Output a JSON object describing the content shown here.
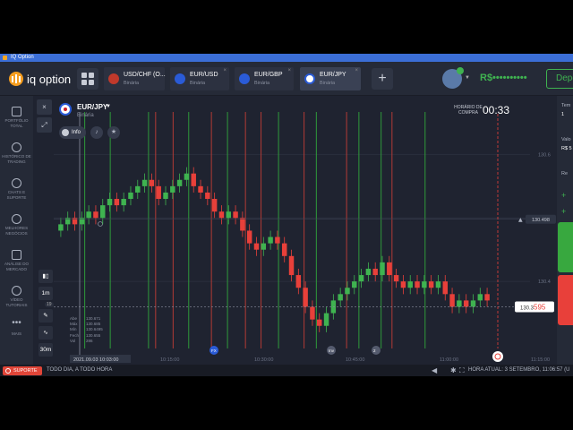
{
  "window": {
    "title": "IQ Option"
  },
  "brand": {
    "name": "iq option"
  },
  "tabs": [
    {
      "name": "USD/CHF (O...",
      "type": "Binária",
      "flag_color": "#c0392b"
    },
    {
      "name": "EUR/USD",
      "type": "Binária",
      "flag_color": "#2a5bd7"
    },
    {
      "name": "EUR/GBP",
      "type": "Binária",
      "flag_color": "#2a5bd7"
    },
    {
      "name": "EUR/JPY",
      "type": "Binária",
      "flag_color": "#2a5bd7"
    }
  ],
  "account": {
    "balance": "R$••••••••••",
    "deposit": "Depo"
  },
  "sidebar": [
    {
      "label": "PORTFÓLIO TOTAL",
      "icon": "briefcase-icon"
    },
    {
      "label": "HISTÓRICO DE TRADING",
      "icon": "history-icon"
    },
    {
      "label": "CHATS E SUPORTE",
      "icon": "chat-icon"
    },
    {
      "label": "MELHORES NEGÓCIOS",
      "icon": "trophy-icon"
    },
    {
      "label": "ANÁLISE DO MERCADO",
      "icon": "news-icon"
    },
    {
      "label": "VÍDEO TUTORIAIS",
      "icon": "play-icon"
    },
    {
      "label": "MAIS",
      "icon": "more-icon"
    }
  ],
  "asset": {
    "name": "EUR/JPY",
    "type": "Binária",
    "info": "Info"
  },
  "countdown": {
    "label": "HORÁRIO DE COMPRA",
    "value": "00:33"
  },
  "timeframes": {
    "candle": "1m",
    "period": "30m",
    "indicator_count": "19"
  },
  "ohlc": [
    {
      "k": "Abe",
      "v": "130.671"
    },
    {
      "k": "Máx",
      "v": "130.685"
    },
    {
      "k": "Mín",
      "v": "130.6495"
    },
    {
      "k": "Fech",
      "v": "130.655"
    },
    {
      "k": "Vol",
      "v": "286"
    }
  ],
  "right_panel": {
    "t1": "Tem",
    "t2": "1",
    "t3": "Valo",
    "t4": "R$ 5",
    "t5": "Re",
    "t6": "+",
    "t7": "+"
  },
  "bottom": {
    "support": "SUPORTE",
    "promo": "TODO DIA, A TODO HORA",
    "time_now": "HORA ATUAL: 3 SETEMBRO, 11:06:57 (U"
  },
  "colors": {
    "up": "#3fb350",
    "down": "#e8403a",
    "bg": "#1f2330",
    "panel": "#252a37"
  },
  "chart_data": {
    "type": "candlestick",
    "price_ticks": [
      "130.6",
      "130.5",
      "130.4"
    ],
    "time_ticks": [
      "2021.09.03 10:03:00",
      "10:15:00",
      "10:30:00",
      "10:45:00",
      "11:00:00",
      "11:15:00"
    ],
    "current_price": "130.3595",
    "current_price_main": "130.3",
    "current_price_tail": "595",
    "line_price": "130.498",
    "event_labels": [
      "FX",
      "Inv",
      "2"
    ],
    "green_verticals": [
      0.058,
      0.112,
      0.193,
      0.278,
      0.36,
      0.468,
      0.548,
      0.638,
      0.685,
      0.778
    ],
    "red_verticals": [
      0.208,
      0.245,
      0.326,
      0.398,
      0.431,
      0.522,
      0.612,
      0.708
    ],
    "ylim": [
      130.3,
      130.65
    ],
    "candles": [
      [
        130.48,
        130.49,
        130.47,
        130.5
      ],
      [
        130.49,
        130.5,
        130.48,
        130.51
      ],
      [
        130.5,
        130.49,
        130.48,
        130.51
      ],
      [
        130.49,
        130.5,
        130.48,
        130.51
      ],
      [
        130.5,
        130.51,
        130.49,
        130.52
      ],
      [
        130.51,
        130.5,
        130.49,
        130.52
      ],
      [
        130.5,
        130.52,
        130.49,
        130.53
      ],
      [
        130.52,
        130.53,
        130.51,
        130.54
      ],
      [
        130.53,
        130.52,
        130.51,
        130.54
      ],
      [
        130.52,
        130.53,
        130.51,
        130.54
      ],
      [
        130.53,
        130.54,
        130.52,
        130.55
      ],
      [
        130.54,
        130.55,
        130.53,
        130.56
      ],
      [
        130.55,
        130.56,
        130.54,
        130.57
      ],
      [
        130.56,
        130.55,
        130.54,
        130.57
      ],
      [
        130.55,
        130.53,
        130.52,
        130.56
      ],
      [
        130.53,
        130.54,
        130.52,
        130.55
      ],
      [
        130.54,
        130.55,
        130.53,
        130.56
      ],
      [
        130.55,
        130.56,
        130.54,
        130.57
      ],
      [
        130.56,
        130.57,
        130.55,
        130.58
      ],
      [
        130.57,
        130.55,
        130.54,
        130.58
      ],
      [
        130.55,
        130.54,
        130.53,
        130.56
      ],
      [
        130.54,
        130.53,
        130.52,
        130.55
      ],
      [
        130.53,
        130.51,
        130.5,
        130.54
      ],
      [
        130.51,
        130.5,
        130.49,
        130.52
      ],
      [
        130.5,
        130.51,
        130.49,
        130.52
      ],
      [
        130.51,
        130.5,
        130.49,
        130.52
      ],
      [
        130.5,
        130.48,
        130.47,
        130.51
      ],
      [
        130.48,
        130.46,
        130.45,
        130.49
      ],
      [
        130.46,
        130.45,
        130.44,
        130.47
      ],
      [
        130.45,
        130.46,
        130.44,
        130.47
      ],
      [
        130.46,
        130.47,
        130.45,
        130.48
      ],
      [
        130.47,
        130.46,
        130.45,
        130.48
      ],
      [
        130.46,
        130.44,
        130.43,
        130.47
      ],
      [
        130.44,
        130.41,
        130.4,
        130.45
      ],
      [
        130.41,
        130.39,
        130.38,
        130.42
      ],
      [
        130.39,
        130.36,
        130.35,
        130.4
      ],
      [
        130.36,
        130.34,
        130.33,
        130.37
      ],
      [
        130.34,
        130.33,
        130.32,
        130.35
      ],
      [
        130.33,
        130.35,
        130.32,
        130.36
      ],
      [
        130.35,
        130.37,
        130.34,
        130.38
      ],
      [
        130.37,
        130.38,
        130.36,
        130.39
      ],
      [
        130.38,
        130.39,
        130.37,
        130.4
      ],
      [
        130.39,
        130.4,
        130.38,
        130.41
      ],
      [
        130.4,
        130.41,
        130.39,
        130.42
      ],
      [
        130.41,
        130.42,
        130.4,
        130.43
      ],
      [
        130.42,
        130.41,
        130.4,
        130.43
      ],
      [
        130.41,
        130.43,
        130.4,
        130.44
      ],
      [
        130.43,
        130.41,
        130.4,
        130.44
      ],
      [
        130.41,
        130.4,
        130.39,
        130.42
      ],
      [
        130.4,
        130.39,
        130.38,
        130.41
      ],
      [
        130.39,
        130.4,
        130.38,
        130.41
      ],
      [
        130.4,
        130.39,
        130.38,
        130.41
      ],
      [
        130.39,
        130.4,
        130.38,
        130.41
      ],
      [
        130.4,
        130.39,
        130.38,
        130.41
      ],
      [
        130.39,
        130.4,
        130.38,
        130.41
      ],
      [
        130.4,
        130.38,
        130.37,
        130.41
      ],
      [
        130.38,
        130.36,
        130.35,
        130.39
      ],
      [
        130.36,
        130.37,
        130.35,
        130.38
      ],
      [
        130.37,
        130.36,
        130.35,
        130.38
      ],
      [
        130.36,
        130.37,
        130.35,
        130.38
      ],
      [
        130.37,
        130.38,
        130.36,
        130.39
      ],
      [
        130.38,
        130.37,
        130.36,
        130.39
      ]
    ]
  }
}
